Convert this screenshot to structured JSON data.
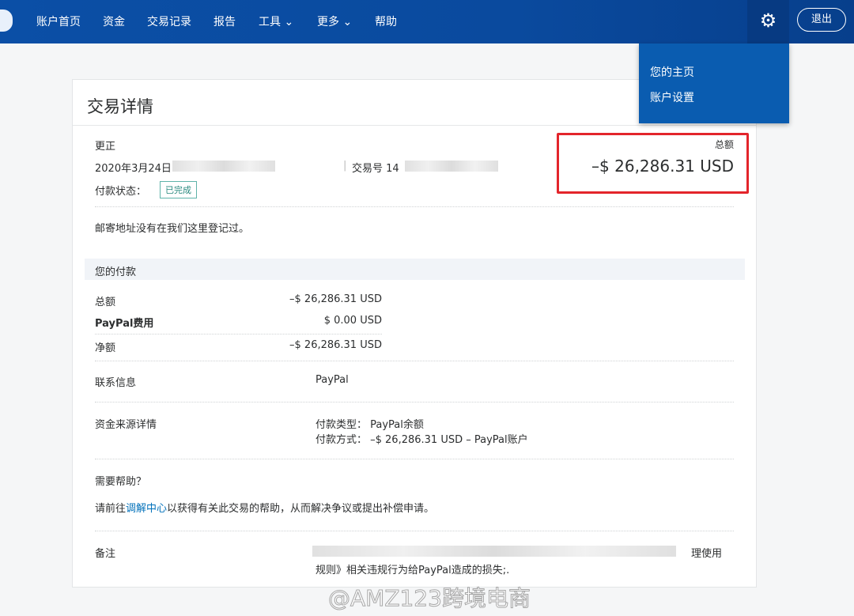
{
  "nav": {
    "items": [
      "账户首页",
      "资金",
      "交易记录",
      "报告",
      "工具 ⌄",
      "更多 ⌄",
      "帮助"
    ],
    "logout": "退出"
  },
  "dropdown": {
    "items": [
      "您的主页",
      "账户设置"
    ]
  },
  "detail": {
    "title": "交易详情",
    "type": "更正",
    "date": "2020年3月24日",
    "txn_label": "交易号 14",
    "status_label": "付款状态：",
    "status": "已完成",
    "total_label": "总额",
    "total": "–$ 26,286.31 USD",
    "address_note": "邮寄地址没有在我们这里登记过。"
  },
  "payment": {
    "section": "您的付款",
    "rows": [
      {
        "label": "总额",
        "value": "–$ 26,286.31 USD"
      },
      {
        "label": "PayPal费用",
        "value": "$ 0.00 USD"
      },
      {
        "label": "净额",
        "value": "–$ 26,286.31 USD"
      }
    ]
  },
  "contact": {
    "label": "联系信息",
    "value": "PayPal"
  },
  "funding": {
    "label": "资金来源详情",
    "type": "付款类型：  PayPal余额",
    "method": "付款方式：  –$ 26,286.31 USD – PayPal账户"
  },
  "help": {
    "title": "需要帮助？",
    "prefix": "请前往",
    "link": "调解中心",
    "suffix": "以获得有关此交易的帮助，从而解决争议或提出补偿申请。"
  },
  "note": {
    "label": "备注",
    "line1_end": "理使用",
    "line2": "规则》相关违规行为给PayPal造成的损失;."
  },
  "watermark": "@AMZ123跨境电商"
}
